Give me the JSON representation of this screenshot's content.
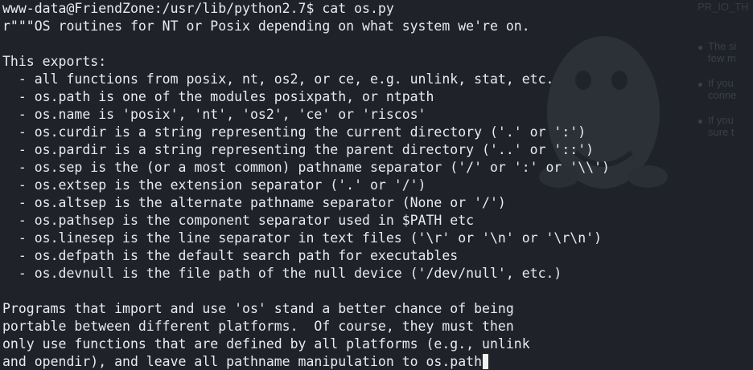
{
  "terminal": {
    "prompt": "www-data@FriendZone:/usr/lib/python2.7$ cat os.py",
    "lines": [
      "r\"\"\"OS routines for NT or Posix depending on what system we're on.",
      "",
      "This exports:",
      "  - all functions from posix, nt, os2, or ce, e.g. unlink, stat, etc.",
      "  - os.path is one of the modules posixpath, or ntpath",
      "  - os.name is 'posix', 'nt', 'os2', 'ce' or 'riscos'",
      "  - os.curdir is a string representing the current directory ('.' or ':')",
      "  - os.pardir is a string representing the parent directory ('..' or '::')",
      "  - os.sep is the (or a most common) pathname separator ('/' or ':' or '\\\\')",
      "  - os.extsep is the extension separator ('.' or '/')",
      "  - os.altsep is the alternate pathname separator (None or '/')",
      "  - os.pathsep is the component separator used in $PATH etc",
      "  - os.linesep is the line separator in text files ('\\r' or '\\n' or '\\r\\n')",
      "  - os.defpath is the default search path for executables",
      "  - os.devnull is the file path of the null device ('/dev/null', etc.)",
      "",
      "Programs that import and use 'os' stand a better chance of being",
      "portable between different platforms.  Of course, they must then",
      "only use functions that are defined by all platforms (e.g., unlink"
    ],
    "last_line": "and opendir), and leave all pathname manipulation to os.path"
  },
  "background": {
    "heading": "PR_IO_TH",
    "bullets": [
      [
        "The si",
        "few m"
      ],
      [
        "If you",
        "conne"
      ],
      [
        "If you",
        "sure t"
      ]
    ]
  }
}
